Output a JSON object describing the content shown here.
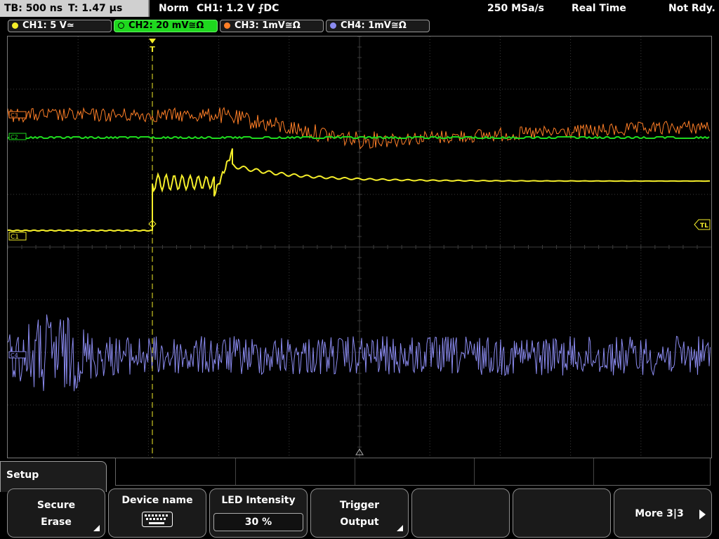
{
  "status": {
    "timebase": "TB: 500 ns",
    "trigger_time": "T: 1.47 µs",
    "trigger_mode": "Norm",
    "trigger_source": "CH1: 1.2 V ⨍DC",
    "sample_rate": "250 MSa/s",
    "acq_mode": "Real Time",
    "run_state": "Not Rdy."
  },
  "channels": [
    {
      "label": "CH1: 5 V≃",
      "color": "#f5ee2a",
      "active": false
    },
    {
      "label": "CH2: 20 mV≅Ω",
      "color": "#1ed81e",
      "active": true
    },
    {
      "label": "CH3: 1mV≅Ω",
      "color": "#ff7f27",
      "active": false
    },
    {
      "label": "CH4: 1mV≅Ω",
      "color": "#8b8bf0",
      "active": false
    }
  ],
  "plot": {
    "ref_markers": {
      "ch1": "C1",
      "ch2": "C2",
      "ch3": "C3",
      "ch4": "C4"
    },
    "trigger_level_label": "TL",
    "trigger_marker": "T"
  },
  "menu": {
    "title": "Setup",
    "softkeys": [
      {
        "l1": "Secure",
        "l2": "Erase",
        "has_submenu": true
      },
      {
        "l1": "Device name",
        "icon": "keyboard-icon"
      },
      {
        "l1": "LED Intensity",
        "value": "30 %"
      },
      {
        "l1": "Trigger",
        "l2": "Output",
        "has_submenu": true
      },
      {
        "l1": ""
      },
      {
        "l1": ""
      },
      {
        "l1": "More 3|3"
      }
    ]
  },
  "colors": {
    "ch1": "#f5ee2a",
    "ch2": "#1ed81e",
    "ch3": "#ff7f27",
    "ch4": "#8b8bf0",
    "grid": "#3c3c3c"
  }
}
